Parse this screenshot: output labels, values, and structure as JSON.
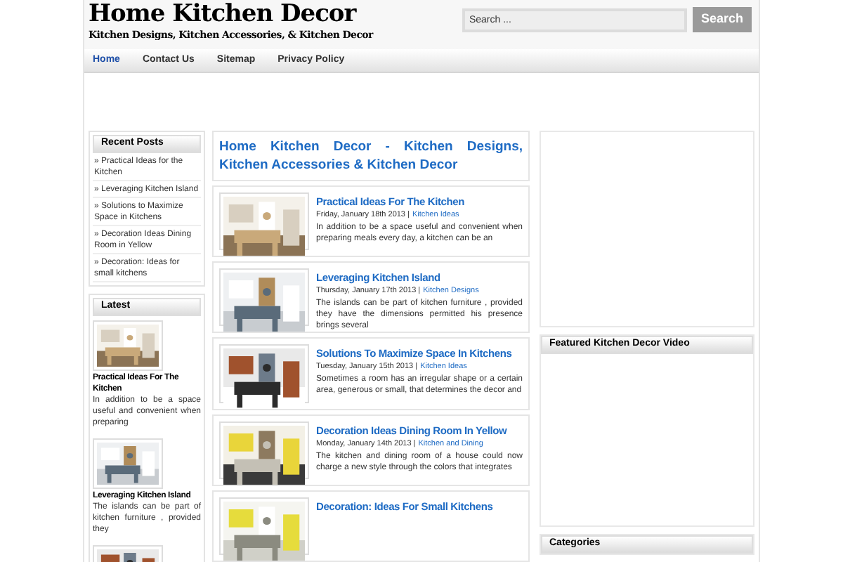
{
  "header": {
    "site_title": "Home Kitchen Decor",
    "tagline": "Kitchen Designs, Kitchen Accessories, & Kitchen Decor",
    "search": {
      "placeholder": "Search ...",
      "button": "Search"
    }
  },
  "nav": [
    {
      "label": "Home",
      "selected": true
    },
    {
      "label": "Contact Us",
      "selected": false
    },
    {
      "label": "Sitemap",
      "selected": false
    },
    {
      "label": "Privacy Policy",
      "selected": false
    }
  ],
  "left_sidebar": {
    "recent_posts": {
      "title": "Recent Posts",
      "items": [
        "» Practical Ideas for the Kitchen",
        "» Leveraging Kitchen Island",
        "» Solutions to Maximize Space in Kitchens",
        "» Decoration Ideas Dining Room in Yellow",
        "» Decoration: Ideas for small kitchens"
      ]
    },
    "latest": {
      "title": "Latest",
      "items": [
        {
          "title": "Practical Ideas For The Kitchen",
          "excerpt": "In addition to be a space useful and convenient when preparing",
          "thumb": {
            "kind": "picture"
          }
        },
        {
          "title": "Leveraging Kitchen Island",
          "excerpt": "The islands can be part of kitchen furniture , provided they",
          "thumb": {
            "kind": "picture"
          }
        },
        {
          "thumb": {
            "kind": "picture"
          }
        }
      ]
    }
  },
  "main": {
    "heading": "Home Kitchen Decor - Kitchen Designs, Kitchen Accessories & Kitchen Decor",
    "posts": [
      {
        "title": "Practical Ideas For The Kitchen",
        "date": "Friday, January 18th 2013 |",
        "category": "Kitchen Ideas",
        "excerpt": "In addition to be a space useful and convenient when preparing meals every day, a kitchen can be an",
        "thumb": {
          "kind": "picture"
        }
      },
      {
        "title": "Leveraging Kitchen Island",
        "date": "Thursday, January 17th 2013 |",
        "category": "Kitchen Designs",
        "excerpt": "The islands can be part of kitchen furniture , provided they have the dimensions permitted his presence brings several",
        "thumb": {
          "kind": "picture"
        }
      },
      {
        "title": "Solutions To Maximize Space In Kitchens",
        "date": "Tuesday, January 15th 2013 |",
        "category": "Kitchen Ideas",
        "excerpt": "Sometimes a room has an irregular shape or a certain area, generous or small, that determines the decor and",
        "thumb": {
          "kind": "picture"
        }
      },
      {
        "title": "Decoration Ideas Dining Room In Yellow",
        "date": "Monday, January 14th 2013 |",
        "category": "Kitchen and Dining",
        "excerpt": "The kitchen and dining room of a house could now charge a new style through the colors that integrates",
        "thumb": {
          "kind": "picture"
        }
      },
      {
        "title": "Decoration: Ideas For Small Kitchens",
        "thumb": {
          "kind": "picture"
        }
      }
    ]
  },
  "right_sidebar": {
    "widgets": [
      {
        "title": "Featured Kitchen Decor Video"
      },
      {
        "title": "Categories"
      }
    ]
  }
}
